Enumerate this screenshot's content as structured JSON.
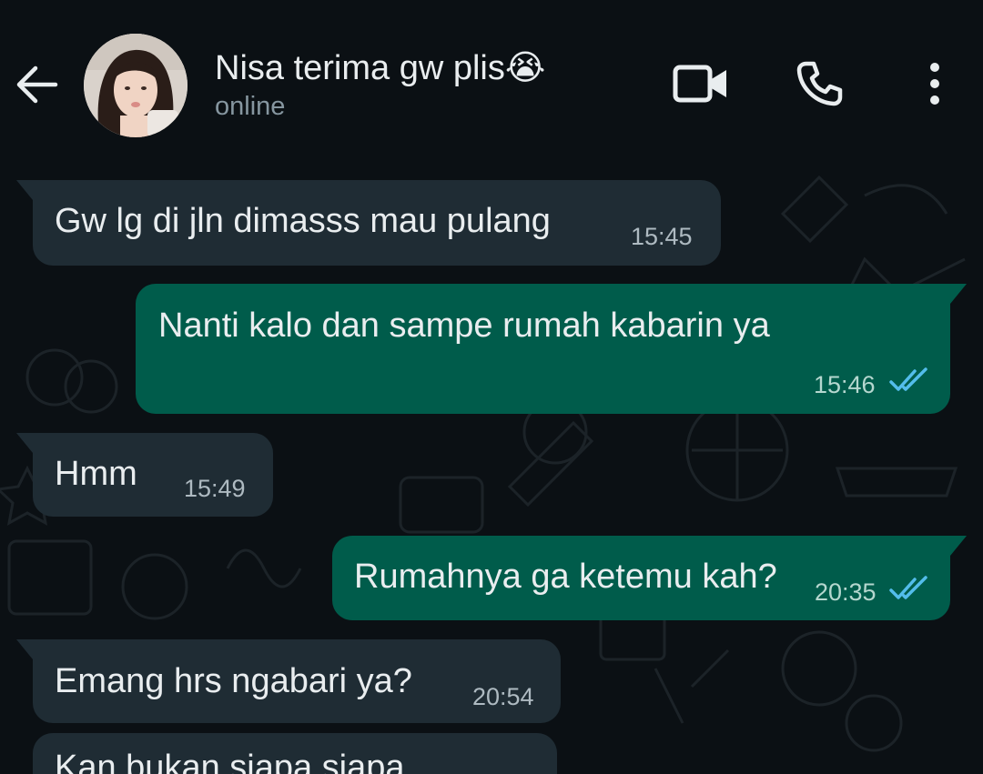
{
  "header": {
    "contact_name": "Nisa terima gw plis😭",
    "status": "online",
    "icons": [
      "back-arrow-icon",
      "avatar",
      "video-call-icon",
      "phone-icon",
      "more-options-icon"
    ]
  },
  "colors": {
    "background": "#0b1014",
    "incoming_bubble": "#1f2c34",
    "outgoing_bubble": "#005c4b",
    "read_ticks": "#53bdeb"
  },
  "messages": [
    {
      "direction": "in",
      "text": "Gw lg di jln dimasss mau pulang",
      "time": "15:45"
    },
    {
      "direction": "out",
      "text": "Nanti kalo dan sampe rumah kabarin ya",
      "time": "15:46",
      "status": "read"
    },
    {
      "direction": "in",
      "text": "Hmm",
      "time": "15:49"
    },
    {
      "direction": "out",
      "text": "Rumahnya ga ketemu kah?",
      "time": "20:35",
      "status": "read"
    },
    {
      "direction": "in",
      "text": "Emang hrs ngabari ya?",
      "time": "20:54"
    },
    {
      "direction": "in",
      "text": "Kan bukan siapa siapa",
      "time": ""
    }
  ]
}
